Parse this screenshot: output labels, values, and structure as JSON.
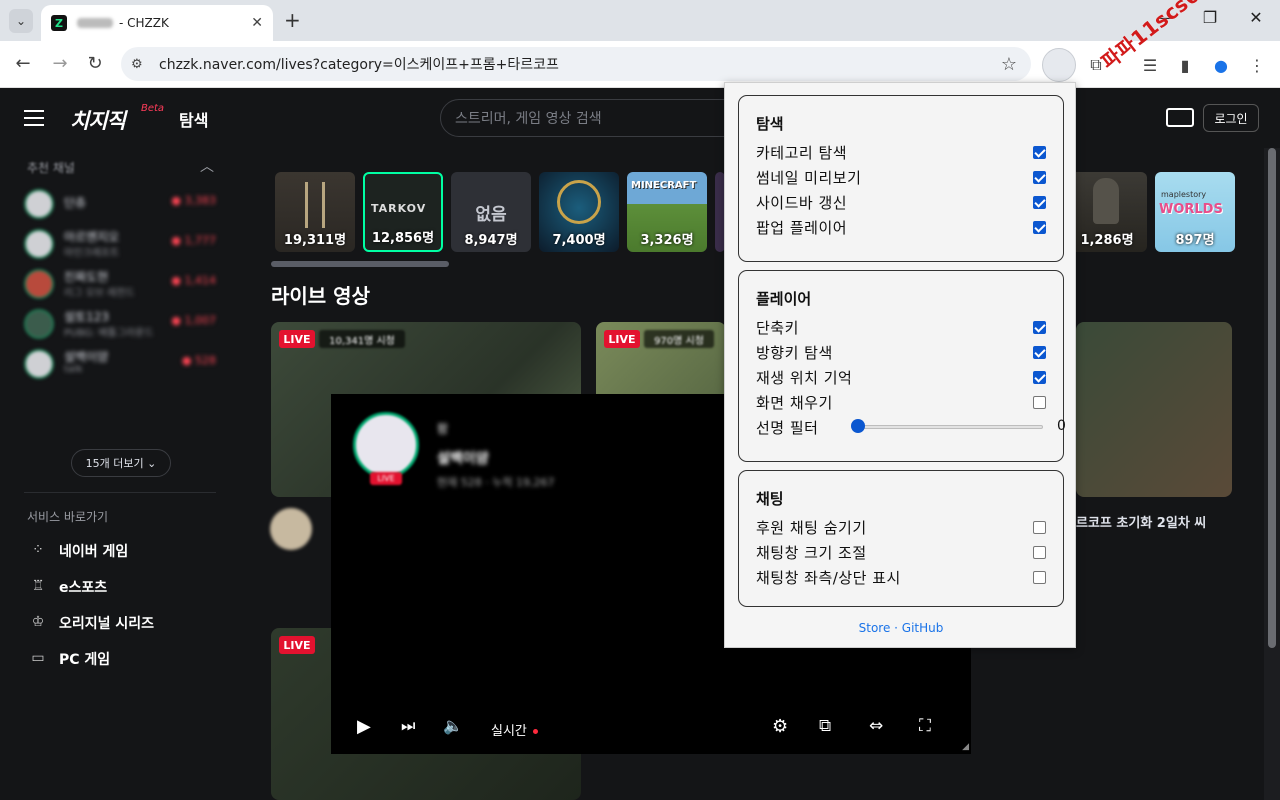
{
  "browser": {
    "tab_title": "- CHZZK",
    "favicon_glyph": "Z",
    "url": "chzzk.naver.com/lives?category=이스케이프+프롬+타르코프",
    "watermark": "파파11scs66"
  },
  "site": {
    "logo": "치지직",
    "beta": "Beta",
    "nav_explore": "탐색",
    "search_placeholder": "스트리머, 게임 영상 검색",
    "login_label": "로그인"
  },
  "sidebar": {
    "recommended_title": "추천 채널",
    "channels": [
      {
        "name": "단츄",
        "sub": "",
        "count": "● 3,383"
      },
      {
        "name": "아르멘지오",
        "sub": "마인크래프트",
        "count": "● 1,777"
      },
      {
        "name": "진짜도현",
        "sub": "리그 오브 레전드",
        "count": "● 1,414"
      },
      {
        "name": "설토123",
        "sub": "PUBG: 배틀그라운드",
        "count": "● 1,007"
      },
      {
        "name": "설백이얌",
        "sub": "talk",
        "count": "● 528"
      }
    ],
    "more_label": "15개 더보기 ⌄",
    "services_title": "서비스 바로가기",
    "services": [
      {
        "label": "네이버 게임",
        "icon": "games-icon"
      },
      {
        "label": "e스포츠",
        "icon": "trophy-icon"
      },
      {
        "label": "오리지널 시리즈",
        "icon": "crown-icon"
      },
      {
        "label": "PC 게임",
        "icon": "monitor-icon"
      }
    ]
  },
  "categories": [
    {
      "name": "elden-ring",
      "count": "19,311명"
    },
    {
      "name": "tarkov",
      "count": "12,856명"
    },
    {
      "name": "none",
      "count": "8,947명",
      "text": "없음"
    },
    {
      "name": "league",
      "count": "7,400명"
    },
    {
      "name": "minecraft",
      "count": "3,326명"
    },
    {
      "name": "pubg",
      "count": "1,286명"
    },
    {
      "name": "maplestory-worlds",
      "count": "897명"
    }
  ],
  "live_section_title": "라이브 영상",
  "cards": [
    {
      "badge": "LIVE",
      "viewers": "10,341명 시청"
    },
    {
      "badge": "LIVE",
      "viewers": "970명 시청"
    },
    {
      "badge": "LIVE",
      "viewers": ""
    }
  ],
  "card_text_right": "르코프 초기화 2일차 씨",
  "player": {
    "line1": "팜",
    "channel": "설백이얌",
    "stats": "현재 528 · 누적 19,267",
    "live": "LIVE",
    "realtime_label": "실시간"
  },
  "popup": {
    "sections": [
      {
        "title": "탐색",
        "options": [
          {
            "label": "카테고리 탐색",
            "checked": true
          },
          {
            "label": "썸네일 미리보기",
            "checked": true
          },
          {
            "label": "사이드바 갱신",
            "checked": true
          },
          {
            "label": "팝업 플레이어",
            "checked": true
          }
        ]
      },
      {
        "title": "플레이어",
        "options": [
          {
            "label": "단축키",
            "checked": true
          },
          {
            "label": "방향키 탐색",
            "checked": true
          },
          {
            "label": "재생 위치 기억",
            "checked": true
          },
          {
            "label": "화면 채우기",
            "checked": false
          }
        ],
        "slider": {
          "label": "선명 필터",
          "value": "0"
        }
      },
      {
        "title": "채팅",
        "options": [
          {
            "label": "후원 채팅 숨기기",
            "checked": false
          },
          {
            "label": "채팅창 크기 조절",
            "checked": false
          },
          {
            "label": "채팅창 좌측/상단 표시",
            "checked": false
          }
        ]
      }
    ],
    "links": "Store · GitHub"
  },
  "colors": {
    "accent": "#00ffa3",
    "live_red": "#e3122f",
    "checkbox_blue": "#0b57d0"
  }
}
